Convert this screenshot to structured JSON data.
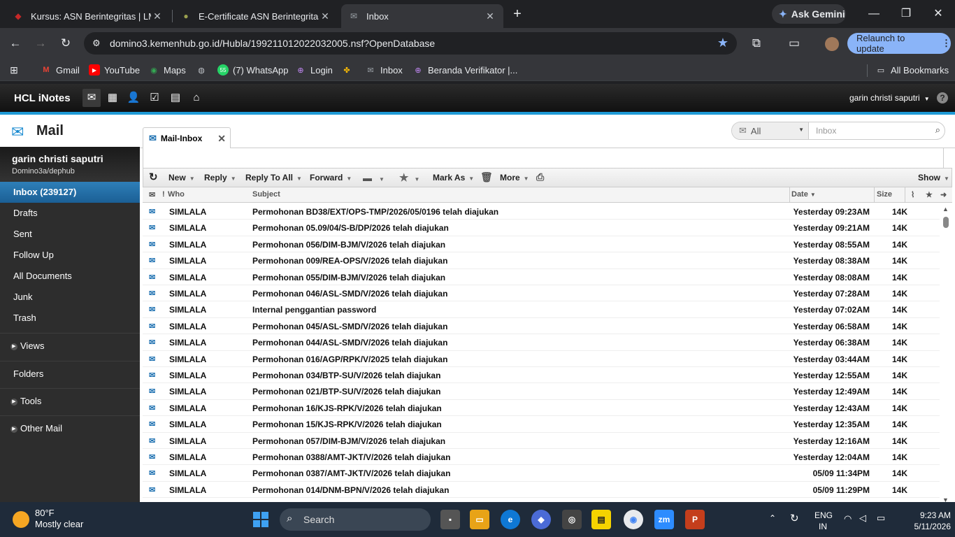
{
  "browser": {
    "tabs": [
      {
        "title": "Kursus: ASN Berintegritas | LMS",
        "active": false
      },
      {
        "title": "E-Certificate ASN Berintegritas",
        "active": false
      },
      {
        "title": "Inbox",
        "active": true
      }
    ],
    "ask_gemini": "Ask Gemini",
    "url": "domino3.kemenhub.go.id/Hubla/199211012022032005.nsf?OpenDatabase",
    "relaunch": "Relaunch to update",
    "bookmarks": [
      "Gmail",
      "YouTube",
      "Maps",
      "(7) WhatsApp",
      "Login",
      "Inbox",
      "Beranda Verifikator |...",
      "All Bookmarks"
    ]
  },
  "inotes": {
    "brand": "HCL iNotes",
    "user_menu": "garin christi saputri",
    "app_title": "Mail",
    "user_name": "garin christi saputri",
    "user_domain": "Domino3a/dephub",
    "nav": [
      "Inbox (239127)",
      "Drafts",
      "Sent",
      "Follow Up",
      "All Documents",
      "Junk",
      "Trash"
    ],
    "sections": [
      "Views",
      "Folders",
      "Tools",
      "Other Mail"
    ],
    "tab": "Mail-Inbox",
    "search_scope": "All",
    "search_placeholder": "Inbox",
    "actions": [
      "New",
      "Reply",
      "Reply To All",
      "Forward",
      "Mark As",
      "More",
      "Show"
    ],
    "columns": {
      "who": "Who",
      "subject": "Subject",
      "date": "Date",
      "size": "Size"
    },
    "messages": [
      {
        "who": "SIMLALA",
        "subject": "Permohonan BD38/EXT/OPS-TMP/2026/05/0196 telah diajukan",
        "date": "Yesterday 09:23AM",
        "size": "14K"
      },
      {
        "who": "SIMLALA",
        "subject": "Permohonan 05.09/04/S-B/DP/2026 telah diajukan",
        "date": "Yesterday 09:21AM",
        "size": "14K"
      },
      {
        "who": "SIMLALA",
        "subject": "Permohonan 056/DIM-BJM/V/2026 telah diajukan",
        "date": "Yesterday 08:55AM",
        "size": "14K"
      },
      {
        "who": "SIMLALA",
        "subject": "Permohonan 009/REA-OPS/V/2026 telah diajukan",
        "date": "Yesterday 08:38AM",
        "size": "14K"
      },
      {
        "who": "SIMLALA",
        "subject": "Permohonan 055/DIM-BJM/V/2026 telah diajukan",
        "date": "Yesterday 08:08AM",
        "size": "14K"
      },
      {
        "who": "SIMLALA",
        "subject": "Permohonan 046/ASL-SMD/V/2026 telah diajukan",
        "date": "Yesterday 07:28AM",
        "size": "14K"
      },
      {
        "who": "SIMLALA",
        "subject": "Internal penggantian password",
        "date": "Yesterday 07:02AM",
        "size": "14K"
      },
      {
        "who": "SIMLALA",
        "subject": "Permohonan 045/ASL-SMD/V/2026 telah diajukan",
        "date": "Yesterday 06:58AM",
        "size": "14K"
      },
      {
        "who": "SIMLALA",
        "subject": "Permohonan 044/ASL-SMD/V/2026 telah diajukan",
        "date": "Yesterday 06:38AM",
        "size": "14K"
      },
      {
        "who": "SIMLALA",
        "subject": "Permohonan 016/AGP/RPK/V/2025 telah diajukan",
        "date": "Yesterday 03:44AM",
        "size": "14K"
      },
      {
        "who": "SIMLALA",
        "subject": "Permohonan 034/BTP-SU/V/2026 telah diajukan",
        "date": "Yesterday 12:55AM",
        "size": "14K"
      },
      {
        "who": "SIMLALA",
        "subject": "Permohonan 021/BTP-SU/V/2026 telah diajukan",
        "date": "Yesterday 12:49AM",
        "size": "14K"
      },
      {
        "who": "SIMLALA",
        "subject": "Permohonan 16/KJS-RPK/V/2026 telah diajukan",
        "date": "Yesterday 12:43AM",
        "size": "14K"
      },
      {
        "who": "SIMLALA",
        "subject": "Permohonan 15/KJS-RPK/V/2026 telah diajukan",
        "date": "Yesterday 12:35AM",
        "size": "14K"
      },
      {
        "who": "SIMLALA",
        "subject": "Permohonan 057/DIM-BJM/V/2026 telah diajukan",
        "date": "Yesterday 12:16AM",
        "size": "14K"
      },
      {
        "who": "SIMLALA",
        "subject": "Permohonan 0388/AMT-JKT/V/2026 telah diajukan",
        "date": "Yesterday 12:04AM",
        "size": "14K"
      },
      {
        "who": "SIMLALA",
        "subject": "Permohonan 0387/AMT-JKT/V/2026 telah diajukan",
        "date": "05/09 11:34PM",
        "size": "14K"
      },
      {
        "who": "SIMLALA",
        "subject": "Permohonan 014/DNM-BPN/V/2026 telah diajukan",
        "date": "05/09 11:29PM",
        "size": "14K"
      }
    ]
  },
  "taskbar": {
    "temperature": "80°F",
    "condition": "Mostly clear",
    "search": "Search",
    "lang1": "ENG",
    "lang2": "IN",
    "time": "9:23 AM",
    "date": "5/11/2026"
  },
  "colors": {
    "accent": "#1e9ad6",
    "selected_nav": "#2e7fb8",
    "relaunch": "#8ab4f8"
  }
}
